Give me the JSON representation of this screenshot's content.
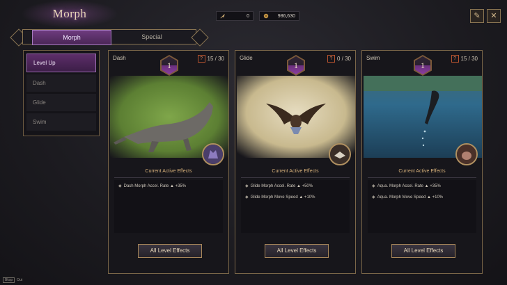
{
  "window": {
    "title": "Morph"
  },
  "tabs": [
    {
      "label": "Morph",
      "active": true
    },
    {
      "label": "Special",
      "active": false
    }
  ],
  "currency": [
    {
      "icon": "feather-icon",
      "value": "0"
    },
    {
      "icon": "coin-icon",
      "value": "986,630"
    }
  ],
  "top_buttons": [
    {
      "icon": "scroll-book-icon"
    },
    {
      "icon": "close-icon"
    }
  ],
  "sidebar": {
    "items": [
      {
        "label": "Level Up",
        "selected": true
      },
      {
        "label": "Dash",
        "selected": false
      },
      {
        "label": "Glide",
        "selected": false
      },
      {
        "label": "Swim",
        "selected": false
      }
    ]
  },
  "cards": [
    {
      "name": "Dash",
      "level": "1",
      "progress": "15 / 30",
      "effects_title": "Current Active Effects",
      "effects": [
        "Dash Morph Accel. Rate ▲ +35%"
      ],
      "button": "All Level Effects"
    },
    {
      "name": "Glide",
      "level": "1",
      "progress": "0 / 30",
      "effects_title": "Current Active Effects",
      "effects": [
        "Glide Morph Accel. Rate ▲ +50%",
        "Glide Morph Move Speed ▲ +10%"
      ],
      "button": "All Level Effects"
    },
    {
      "name": "Swim",
      "level": "1",
      "progress": "15 / 30",
      "effects_title": "Current Active Effects",
      "effects": [
        "Aqua. Morph Accel. Rate ▲ +35%",
        "Aqua. Morph Move Speed ▲ +10%"
      ],
      "button": "All Level Effects"
    }
  ],
  "footer": {
    "key": "Bksp",
    "label": "Out"
  },
  "colors": {
    "accent": "#6d3b7e",
    "gold": "#a8875a",
    "highlight": "#d6b07a"
  }
}
